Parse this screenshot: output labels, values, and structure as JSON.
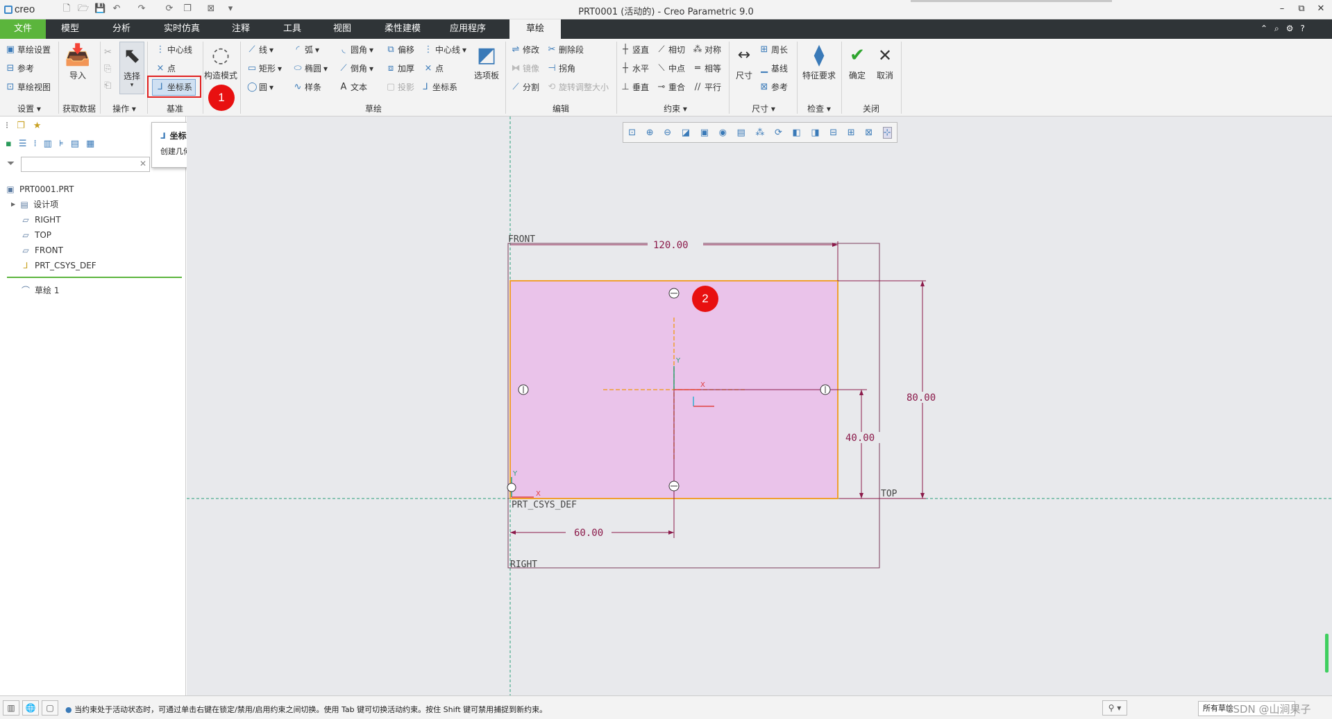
{
  "app": {
    "logo": "creo",
    "window_title": "PRT0001 (活动的) - Creo Parametric 9.0",
    "window_controls": [
      "–",
      "⧉",
      "✕"
    ]
  },
  "tabs": [
    "文件",
    "模型",
    "分析",
    "实时仿真",
    "注释",
    "工具",
    "视图",
    "柔性建模",
    "应用程序",
    "草绘"
  ],
  "ribbon": {
    "setup": {
      "items": [
        "草绘设置",
        "参考",
        "草绘视图"
      ],
      "label": "设置"
    },
    "get_data": {
      "import": "导入",
      "label": "获取数据"
    },
    "operations": {
      "select": "选择",
      "label": "操作"
    },
    "datum": {
      "items": [
        "中心线",
        "点",
        "坐标系"
      ],
      "label": "基准"
    },
    "construction_mode": "构造模式",
    "sketch": {
      "col1": [
        "线",
        "矩形",
        "圆"
      ],
      "col2": [
        "弧",
        "椭圆",
        "样条"
      ],
      "col3": [
        "圆角",
        "倒角",
        "文本"
      ],
      "col4": [
        "偏移",
        "加厚",
        "投影"
      ],
      "col5": [
        "中心线",
        "点",
        "坐标系"
      ],
      "palette": "选项板",
      "label": "草绘"
    },
    "edit": {
      "items": [
        "修改",
        "删除段",
        "镜像",
        "拐角",
        "分割",
        "旋转调整大小"
      ],
      "label": "编辑"
    },
    "constrain": {
      "items": [
        "竖直",
        "相切",
        "对称",
        "水平",
        "中点",
        "相等",
        "垂直",
        "重合",
        "平行"
      ],
      "label": "约束"
    },
    "dimension": {
      "dim": "尺寸",
      "items": [
        "周长",
        "基线",
        "参考"
      ],
      "label": "尺寸"
    },
    "inspect": {
      "feature_req": "特征要求",
      "label": "检查"
    },
    "close": {
      "ok": "确定",
      "cancel": "取消",
      "label": "关闭"
    }
  },
  "tooltip": {
    "title": "坐标系",
    "desc": "创建几何坐标系。"
  },
  "model_tree": {
    "root": "PRT0001.PRT",
    "items": [
      "设计项",
      "RIGHT",
      "TOP",
      "FRONT",
      "PRT_CSYS_DEF"
    ],
    "sketch": "草绘 1"
  },
  "canvas": {
    "dims": {
      "width": "120.00",
      "height": "80.00",
      "half_height": "40.00",
      "half_width": "60.00"
    },
    "datum_labels": {
      "front": "FRONT",
      "top": "TOP",
      "right": "RIGHT",
      "csys": "PRT_CSYS_DEF"
    },
    "axis_labels": {
      "x": "X",
      "y": "Y"
    },
    "colors": {
      "sketch_fill": "#eac3ea",
      "sketch_edge": "#f0a030",
      "dimension": "#8b1a4a",
      "datum": "#2aa07a"
    }
  },
  "callouts": [
    "1",
    "2"
  ],
  "status": {
    "message": "当约束处于活动状态时，可通过单击右键在锁定/禁用/启用约束之间切换。使用 Tab 键可切换活动约束。按住 Shift 键可禁用捕捉到新约束。",
    "filter": "所有草绘",
    "watermark": "CSDN @山涧果子"
  }
}
